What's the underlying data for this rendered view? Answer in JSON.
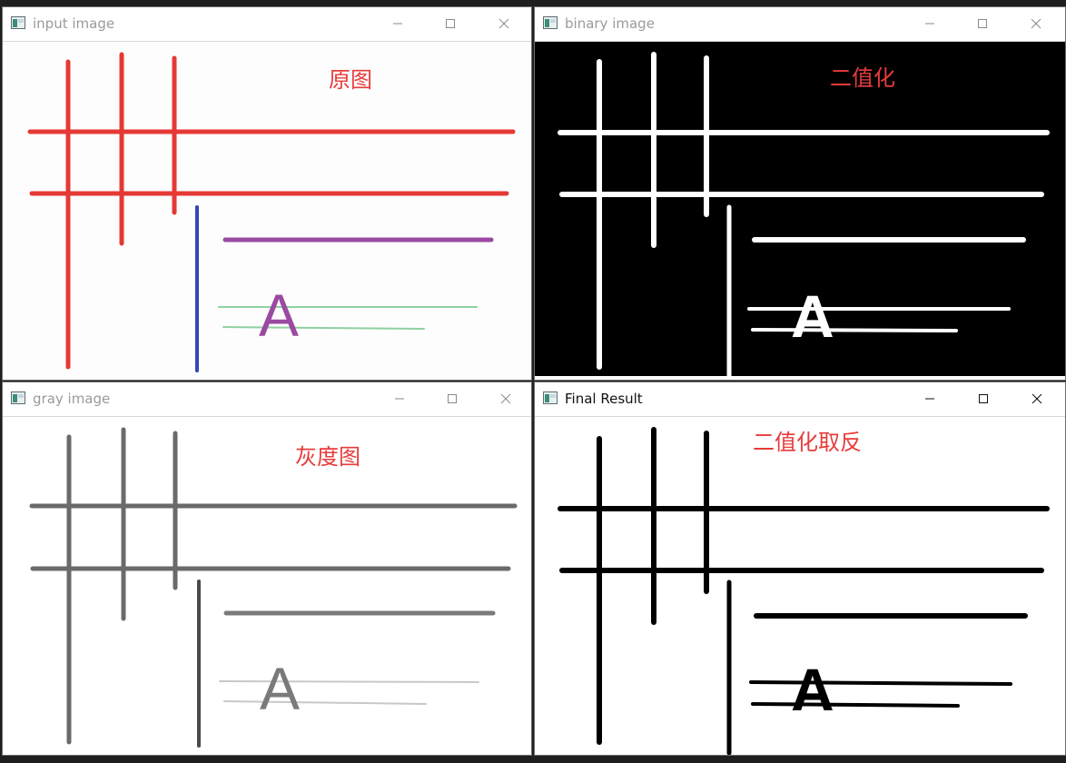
{
  "windows": [
    {
      "id": "input",
      "title": "input image",
      "active": false,
      "annotation": "原图",
      "glyph": "A",
      "theme": "color",
      "colors": {
        "background": "#fdfdfd",
        "grid": "#e53935",
        "vertical": "#3347b8",
        "purple": "#9b4aa2",
        "green": "#8fd1a0",
        "letter": "#9b4aa2"
      }
    },
    {
      "id": "binary",
      "title": "binary image",
      "active": false,
      "annotation": "二值化",
      "glyph": "A",
      "theme": "dark",
      "colors": {
        "background": "#000000",
        "stroke": "#ffffff"
      }
    },
    {
      "id": "gray",
      "title": "gray image",
      "active": false,
      "annotation": "灰度图",
      "glyph": "A",
      "theme": "gray",
      "colors": {
        "background": "#ffffff",
        "dark": "#6a6a6a",
        "mid": "#8a8a8a",
        "light": "#c8c8c8"
      }
    },
    {
      "id": "final",
      "title": "Final Result",
      "active": true,
      "annotation": "二值化取反",
      "glyph": "A",
      "theme": "inverted",
      "colors": {
        "background": "#ffffff",
        "stroke": "#000000"
      }
    }
  ],
  "controls": {
    "minimize_icon": "minimize-icon",
    "maximize_icon": "maximize-icon",
    "close_icon": "close-icon"
  },
  "accent": {
    "annotation_color": "#e83b3b"
  }
}
